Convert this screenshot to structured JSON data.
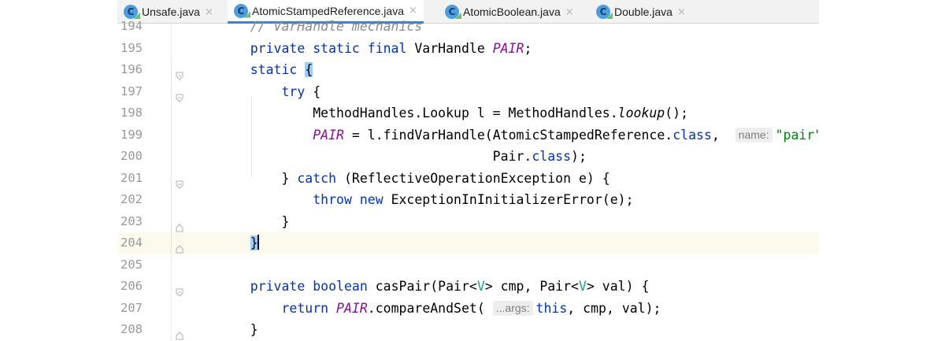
{
  "tabs": [
    {
      "icon": "C",
      "label": "Unsafe.java",
      "close": "×",
      "active": false
    },
    {
      "icon": "C",
      "label": "AtomicStampedReference.java",
      "close": "×",
      "active": true
    },
    {
      "icon": "C",
      "label": "AtomicBoolean.java",
      "close": "×",
      "active": false
    },
    {
      "icon": "C",
      "label": "Double.java",
      "close": "×",
      "active": false
    }
  ],
  "editor": {
    "current_line": "204",
    "lines": [
      {
        "n": "194",
        "fold": "",
        "segs": [
          [
            "    ",
            ""
          ],
          [
            "// VarHandle mechanics",
            "cmt"
          ]
        ]
      },
      {
        "n": "195",
        "fold": "",
        "segs": [
          [
            "    ",
            ""
          ],
          [
            "private static final ",
            "kw"
          ],
          [
            "VarHandle ",
            ""
          ],
          [
            "PAIR",
            "fld"
          ],
          [
            ";",
            ""
          ]
        ]
      },
      {
        "n": "196",
        "fold": "open",
        "segs": [
          [
            "    ",
            ""
          ],
          [
            "static ",
            "kw"
          ],
          [
            "{",
            "brace-hl"
          ]
        ]
      },
      {
        "n": "197",
        "fold": "open",
        "segs": [
          [
            "        ",
            ""
          ],
          [
            "try ",
            "kw"
          ],
          [
            "{",
            ""
          ]
        ]
      },
      {
        "n": "198",
        "fold": "",
        "segs": [
          [
            "            MethodHandles.Lookup l = MethodHandles.",
            ""
          ],
          [
            "lookup",
            "itl"
          ],
          [
            "();",
            ""
          ]
        ]
      },
      {
        "n": "199",
        "fold": "",
        "segs": [
          [
            "            ",
            ""
          ],
          [
            "PAIR",
            "fld"
          ],
          [
            " = l.findVarHandle(AtomicStampedReference.",
            ""
          ],
          [
            "class",
            "kw"
          ],
          [
            ",  ",
            ""
          ],
          [
            "name:",
            "hint"
          ],
          [
            "\"pair\"",
            "str"
          ],
          [
            ",",
            ""
          ]
        ]
      },
      {
        "n": "200",
        "fold": "",
        "segs": [
          [
            "                                   Pair.",
            ""
          ],
          [
            "class",
            "kw"
          ],
          [
            ");",
            ""
          ]
        ]
      },
      {
        "n": "201",
        "fold": "open",
        "segs": [
          [
            "        } ",
            ""
          ],
          [
            "catch ",
            "kw"
          ],
          [
            "(ReflectiveOperationException e) {",
            ""
          ]
        ]
      },
      {
        "n": "202",
        "fold": "",
        "segs": [
          [
            "            ",
            ""
          ],
          [
            "throw new ",
            "kw"
          ],
          [
            "ExceptionInInitializerError(e);",
            ""
          ]
        ]
      },
      {
        "n": "203",
        "fold": "end",
        "segs": [
          [
            "        }",
            ""
          ]
        ]
      },
      {
        "n": "204",
        "fold": "end",
        "segs": [
          [
            "    ",
            ""
          ],
          [
            "}",
            "brace-hl"
          ],
          [
            "",
            "caret"
          ]
        ]
      },
      {
        "n": "205",
        "fold": "",
        "segs": []
      },
      {
        "n": "206",
        "fold": "open",
        "segs": [
          [
            "    ",
            ""
          ],
          [
            "private boolean ",
            "kw"
          ],
          [
            "casPair(Pair<",
            ""
          ],
          [
            "V",
            "tp"
          ],
          [
            "> cmp, Pair<",
            ""
          ],
          [
            "V",
            "tp"
          ],
          [
            "> val) {",
            ""
          ]
        ]
      },
      {
        "n": "207",
        "fold": "",
        "segs": [
          [
            "        ",
            ""
          ],
          [
            "return ",
            "kw"
          ],
          [
            "PAIR",
            "fld"
          ],
          [
            ".compareAndSet( ",
            ""
          ],
          [
            "...args:",
            "hint"
          ],
          [
            "this",
            "kw"
          ],
          [
            ", cmp, val);",
            ""
          ]
        ]
      },
      {
        "n": "208",
        "fold": "end",
        "segs": [
          [
            "    }",
            ""
          ]
        ]
      }
    ]
  }
}
